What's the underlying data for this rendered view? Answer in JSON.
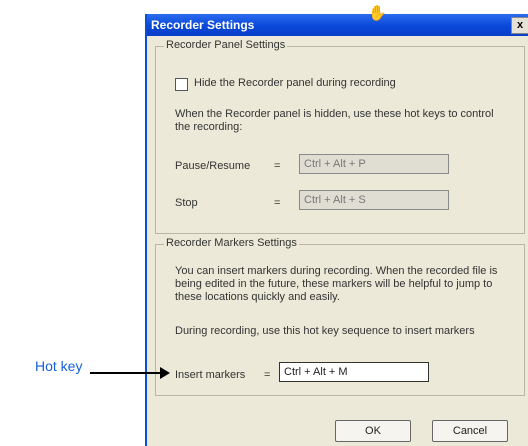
{
  "window": {
    "title": "Recorder Settings",
    "close_label": "x"
  },
  "panel": {
    "group_title": "Recorder Panel Settings",
    "hide_checkbox_label": "Hide the Recorder panel during recording",
    "hide_checked": false,
    "description": "When the Recorder panel is hidden, use these hot keys to control the recording:",
    "pause_label": "Pause/Resume",
    "pause_eq": "=",
    "pause_value": "Ctrl + Alt + P",
    "stop_label": "Stop",
    "stop_eq": "=",
    "stop_value": "Ctrl + Alt + S"
  },
  "markers": {
    "group_title": "Recorder Markers Settings",
    "description": "You can insert markers during recording. When the recorded file is being edited in the future, these markers will be helpful to jump to these locations quickly and easily.",
    "hotkey_instruction": "During recording, use this hot key sequence to insert markers",
    "insert_label": "Insert markers",
    "insert_eq": "=",
    "insert_value": "Ctrl + Alt + M"
  },
  "buttons": {
    "ok": "OK",
    "cancel": "Cancel"
  },
  "annotation": {
    "hot_key_label": "Hot key"
  },
  "icons": {
    "cursor": "hand-cursor-icon",
    "arrow": "arrow-right-icon"
  },
  "colors": {
    "titlebar": "#0a48d8",
    "dialog_bg": "#ece9d8",
    "callout_text": "#1560d8"
  }
}
